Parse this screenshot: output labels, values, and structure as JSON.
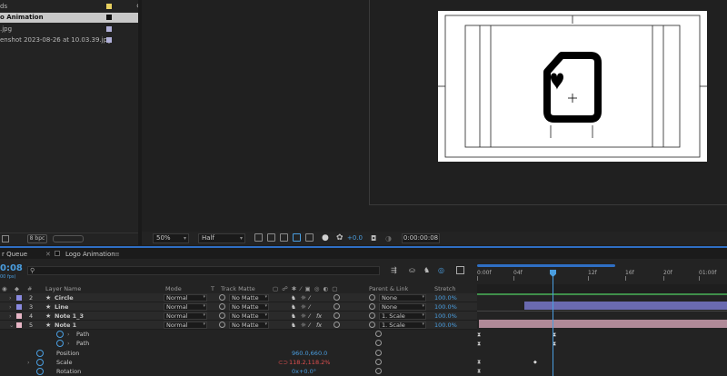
{
  "project": {
    "header": "ds",
    "items": [
      {
        "name": "o Animation",
        "swatch": "#111111",
        "selected": true
      },
      {
        "name": ".jpg",
        "swatch": "#b0b0d8",
        "selected": false
      },
      {
        "name": "enshot 2023-08-26 at 10.03.39.jpg",
        "swatch": "#b0b0d8",
        "selected": false
      }
    ],
    "header_swatch": "#e8d060",
    "bpc": "8 bpc"
  },
  "viewer_toolbar": {
    "zoom": "50%",
    "resolution": "Half",
    "exposure": "+0.0",
    "timecode": "0:00:00:08"
  },
  "tabs": {
    "render_queue": "r Queue",
    "comp": "Logo Animation"
  },
  "timeline": {
    "current_time": "0:08",
    "fps": "00 fps)",
    "search_placeholder": "",
    "headers": {
      "layer_name": "Layer Name",
      "mode": "Mode",
      "t": "T",
      "track_matte": "Track Matte",
      "parent": "Parent & Link",
      "stretch": "Stretch"
    },
    "layers": [
      {
        "num": "2",
        "name": "Circle",
        "color": "#8a8ae0",
        "mode": "Normal",
        "matte": "No Matte",
        "parent": "None",
        "stretch": "100.0%",
        "fx": false
      },
      {
        "num": "3",
        "name": "Line",
        "color": "#8a8ae0",
        "mode": "Normal",
        "matte": "No Matte",
        "parent": "None",
        "stretch": "100.0%",
        "fx": false
      },
      {
        "num": "4",
        "name": "Note 1_3",
        "color": "#e8b6c6",
        "mode": "Normal",
        "matte": "No Matte",
        "parent": "1. Scale",
        "stretch": "100.0%",
        "fx": true
      },
      {
        "num": "5",
        "name": "Note 1",
        "color": "#e8b6c6",
        "mode": "Normal",
        "matte": "No Matte",
        "parent": "1. Scale",
        "stretch": "100.0%",
        "fx": true
      }
    ],
    "properties": [
      {
        "name": "Path",
        "value": ""
      },
      {
        "name": "Path",
        "value": ""
      },
      {
        "name": "Position",
        "value": "960.0,660.0"
      },
      {
        "name": "Scale",
        "value": "118.2,118.2%"
      },
      {
        "name": "Rotation",
        "value": "0x+0.0°"
      }
    ],
    "ruler": [
      "0:00f",
      "04f",
      "08f",
      "12f",
      "16f",
      "20f",
      "01:00f"
    ],
    "bars": [
      {
        "color": "#3f8f4a"
      },
      {
        "color": "#6a6ab0"
      },
      {
        "color": "#b08a98"
      }
    ]
  }
}
